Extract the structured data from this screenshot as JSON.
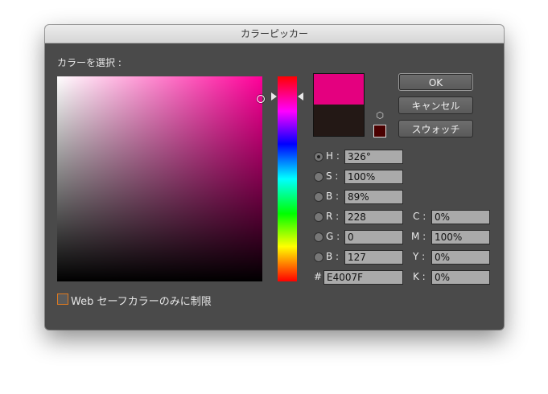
{
  "window": {
    "title": "カラーピッカー"
  },
  "picker": {
    "select_label": "カラーを選択 :"
  },
  "swatches": {
    "new_color": "#e4007f",
    "old_color": "#231815",
    "gamut_warning_color": "#4a0000",
    "gamut_icon": "cube-icon"
  },
  "buttons": {
    "ok": "OK",
    "cancel": "キャンセル",
    "swatches": "スウォッチ"
  },
  "fields": {
    "h": {
      "label": "H :",
      "value": "326°"
    },
    "s": {
      "label": "S :",
      "value": "100%"
    },
    "b": {
      "label": "B :",
      "value": "89%"
    },
    "r": {
      "label": "R :",
      "value": "228"
    },
    "g": {
      "label": "G :",
      "value": "0"
    },
    "b2": {
      "label": "B :",
      "value": "127"
    },
    "hex": {
      "label": "#",
      "value": "E4007F"
    },
    "c": {
      "label": "C :",
      "value": "0%"
    },
    "m": {
      "label": "M :",
      "value": "100%"
    },
    "y": {
      "label": "Y :",
      "value": "0%"
    },
    "k": {
      "label": "K :",
      "value": "0%"
    }
  },
  "web_safe": {
    "label": "Web セーフカラーのみに制限",
    "checked": false
  }
}
